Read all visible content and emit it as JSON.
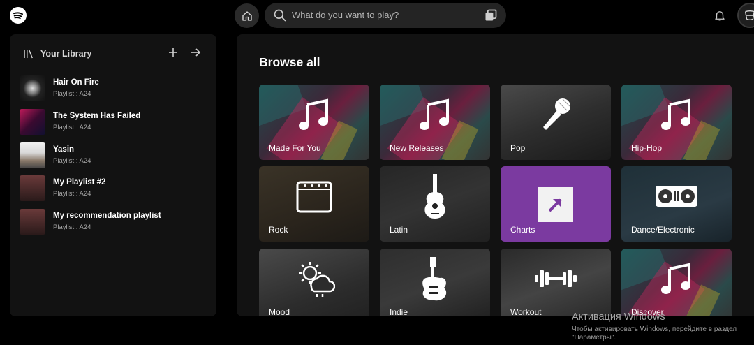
{
  "topbar": {
    "search_placeholder": "What do you want to play?",
    "icons": [
      "spotify-logo",
      "home-icon",
      "search-icon",
      "browse-icon",
      "bell-icon",
      "avatar"
    ]
  },
  "sidebar": {
    "title": "Your Library",
    "playlists": [
      {
        "name": "Hair On Fire",
        "meta": "Playlist : A24"
      },
      {
        "name": "The System Has Failed",
        "meta": "Playlist : A24"
      },
      {
        "name": "Yasin",
        "meta": "Playlist : A24"
      },
      {
        "name": "My Playlist #2",
        "meta": "Playlist : A24"
      },
      {
        "name": "My recommendation playlist",
        "meta": "Playlist : A24"
      }
    ]
  },
  "main": {
    "title": "Browse all",
    "categories": [
      {
        "label": "Made For You",
        "icon": "music-note-icon"
      },
      {
        "label": "New Releases",
        "icon": "music-note-icon"
      },
      {
        "label": "Pop",
        "icon": "microphone-icon"
      },
      {
        "label": "Hip-Hop",
        "icon": "music-note-icon"
      },
      {
        "label": "Rock",
        "icon": "amplifier-icon"
      },
      {
        "label": "Latin",
        "icon": "acoustic-guitar-icon"
      },
      {
        "label": "Charts",
        "icon": "trending-arrow-icon"
      },
      {
        "label": "Dance/Electronic",
        "icon": "turntable-icon"
      },
      {
        "label": "Mood",
        "icon": "weather-icon"
      },
      {
        "label": "Indie",
        "icon": "electric-guitar-icon"
      },
      {
        "label": "Workout",
        "icon": "dumbbell-icon"
      },
      {
        "label": "Discover",
        "icon": "music-note-icon"
      }
    ]
  },
  "watermark": {
    "line1": "Активация Windows",
    "line2": "Чтобы активировать Windows, перейдите в раздел",
    "line3": "\"Параметры\"."
  },
  "colors": {
    "accent": "#1db954",
    "charts": "#7b3aa0",
    "panel": "#121212"
  }
}
